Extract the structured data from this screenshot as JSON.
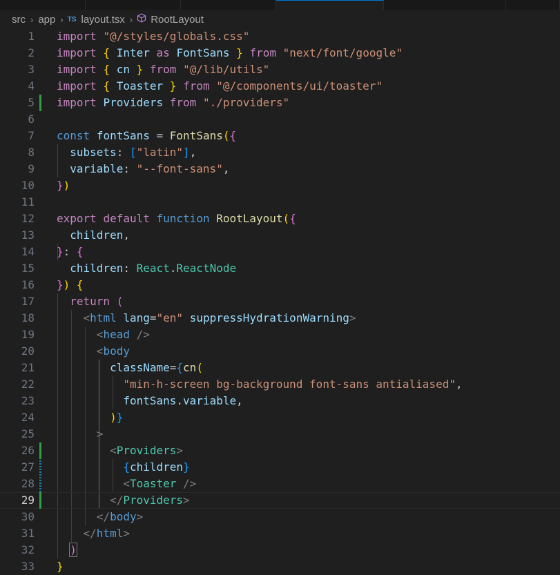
{
  "breadcrumb": {
    "items": [
      "src",
      "app",
      "layout.tsx",
      "RootLayout"
    ],
    "file_icon_text": "TS"
  },
  "editor": {
    "current_line": 29,
    "lines": [
      {
        "n": "1",
        "tokens": [
          [
            "kw",
            "import"
          ],
          [
            "p",
            " "
          ],
          [
            "str",
            "\"@/styles/globals.css\""
          ]
        ]
      },
      {
        "n": "2",
        "tokens": [
          [
            "kw",
            "import"
          ],
          [
            "p",
            " "
          ],
          [
            "b1",
            "{"
          ],
          [
            "p",
            " "
          ],
          [
            "var",
            "Inter"
          ],
          [
            "p",
            " "
          ],
          [
            "kw",
            "as"
          ],
          [
            "p",
            " "
          ],
          [
            "var",
            "FontSans"
          ],
          [
            "p",
            " "
          ],
          [
            "b1",
            "}"
          ],
          [
            "p",
            " "
          ],
          [
            "kw",
            "from"
          ],
          [
            "p",
            " "
          ],
          [
            "str",
            "\"next/font/google\""
          ]
        ]
      },
      {
        "n": "3",
        "tokens": [
          [
            "kw",
            "import"
          ],
          [
            "p",
            " "
          ],
          [
            "b1",
            "{"
          ],
          [
            "p",
            " "
          ],
          [
            "var",
            "cn"
          ],
          [
            "p",
            " "
          ],
          [
            "b1",
            "}"
          ],
          [
            "p",
            " "
          ],
          [
            "kw",
            "from"
          ],
          [
            "p",
            " "
          ],
          [
            "str",
            "\"@/lib/utils\""
          ]
        ]
      },
      {
        "n": "4",
        "tokens": [
          [
            "kw",
            "import"
          ],
          [
            "p",
            " "
          ],
          [
            "b1",
            "{"
          ],
          [
            "p",
            " "
          ],
          [
            "var",
            "Toaster"
          ],
          [
            "p",
            " "
          ],
          [
            "b1",
            "}"
          ],
          [
            "p",
            " "
          ],
          [
            "kw",
            "from"
          ],
          [
            "p",
            " "
          ],
          [
            "str",
            "\"@/components/ui/toaster\""
          ]
        ]
      },
      {
        "n": "5",
        "gutter": "added",
        "tokens": [
          [
            "kw",
            "import"
          ],
          [
            "p",
            " "
          ],
          [
            "var",
            "Providers"
          ],
          [
            "p",
            " "
          ],
          [
            "kw",
            "from"
          ],
          [
            "p",
            " "
          ],
          [
            "str",
            "\"./providers\""
          ]
        ]
      },
      {
        "n": "6",
        "tokens": []
      },
      {
        "n": "7",
        "tokens": [
          [
            "st",
            "const"
          ],
          [
            "p",
            " "
          ],
          [
            "var",
            "fontSans"
          ],
          [
            "p",
            " = "
          ],
          [
            "fn",
            "FontSans"
          ],
          [
            "b1",
            "("
          ],
          [
            "b2",
            "{"
          ]
        ]
      },
      {
        "n": "8",
        "tokens": [
          [
            "p",
            "  "
          ],
          [
            "var",
            "subsets"
          ],
          [
            "p",
            ": "
          ],
          [
            "b3",
            "["
          ],
          [
            "str",
            "\"latin\""
          ],
          [
            "b3",
            "]"
          ],
          [
            "p",
            ","
          ]
        ]
      },
      {
        "n": "9",
        "tokens": [
          [
            "p",
            "  "
          ],
          [
            "var",
            "variable"
          ],
          [
            "p",
            ": "
          ],
          [
            "str",
            "\"--font-sans\""
          ],
          [
            "p",
            ","
          ]
        ]
      },
      {
        "n": "10",
        "tokens": [
          [
            "b2",
            "}"
          ],
          [
            "b1",
            ")"
          ]
        ]
      },
      {
        "n": "11",
        "tokens": []
      },
      {
        "n": "12",
        "tokens": [
          [
            "kw",
            "export"
          ],
          [
            "p",
            " "
          ],
          [
            "kw",
            "default"
          ],
          [
            "p",
            " "
          ],
          [
            "st",
            "function"
          ],
          [
            "p",
            " "
          ],
          [
            "fn",
            "RootLayout"
          ],
          [
            "b1",
            "("
          ],
          [
            "b2",
            "{"
          ]
        ]
      },
      {
        "n": "13",
        "tokens": [
          [
            "p",
            "  "
          ],
          [
            "var",
            "children"
          ],
          [
            "p",
            ","
          ]
        ]
      },
      {
        "n": "14",
        "tokens": [
          [
            "b2",
            "}"
          ],
          [
            "p",
            ": "
          ],
          [
            "b2",
            "{"
          ]
        ]
      },
      {
        "n": "15",
        "tokens": [
          [
            "p",
            "  "
          ],
          [
            "var",
            "children"
          ],
          [
            "p",
            ": "
          ],
          [
            "ty",
            "React"
          ],
          [
            "p",
            "."
          ],
          [
            "ty",
            "ReactNode"
          ]
        ]
      },
      {
        "n": "16",
        "tokens": [
          [
            "b2",
            "}"
          ],
          [
            "b1",
            ")"
          ],
          [
            "p",
            " "
          ],
          [
            "b1",
            "{"
          ]
        ]
      },
      {
        "n": "17",
        "tokens": [
          [
            "p",
            "  "
          ],
          [
            "kw",
            "return"
          ],
          [
            "p",
            " "
          ],
          [
            "b2",
            "("
          ]
        ]
      },
      {
        "n": "18",
        "tokens": [
          [
            "p",
            "    "
          ],
          [
            "ang",
            "<"
          ],
          [
            "tag",
            "html"
          ],
          [
            "p",
            " "
          ],
          [
            "var",
            "lang"
          ],
          [
            "p",
            "="
          ],
          [
            "str",
            "\"en\""
          ],
          [
            "p",
            " "
          ],
          [
            "var",
            "suppressHydrationWarning"
          ],
          [
            "ang",
            ">"
          ]
        ]
      },
      {
        "n": "19",
        "tokens": [
          [
            "p",
            "      "
          ],
          [
            "ang",
            "<"
          ],
          [
            "tag",
            "head"
          ],
          [
            "p",
            " "
          ],
          [
            "ang",
            "/>"
          ]
        ]
      },
      {
        "n": "20",
        "tokens": [
          [
            "p",
            "      "
          ],
          [
            "ang",
            "<"
          ],
          [
            "tag",
            "body"
          ]
        ]
      },
      {
        "n": "21",
        "tokens": [
          [
            "p",
            "        "
          ],
          [
            "var",
            "className"
          ],
          [
            "p",
            "="
          ],
          [
            "b3",
            "{"
          ],
          [
            "fn",
            "cn"
          ],
          [
            "b1",
            "("
          ]
        ]
      },
      {
        "n": "22",
        "tokens": [
          [
            "p",
            "          "
          ],
          [
            "str",
            "\"min-h-screen bg-background font-sans antialiased\""
          ],
          [
            "p",
            ","
          ]
        ]
      },
      {
        "n": "23",
        "tokens": [
          [
            "p",
            "          "
          ],
          [
            "var",
            "fontSans"
          ],
          [
            "p",
            "."
          ],
          [
            "var",
            "variable"
          ],
          [
            "p",
            ","
          ]
        ]
      },
      {
        "n": "24",
        "tokens": [
          [
            "p",
            "        "
          ],
          [
            "b1",
            ")"
          ],
          [
            "b3",
            "}"
          ]
        ]
      },
      {
        "n": "25",
        "tokens": [
          [
            "p",
            "      "
          ],
          [
            "ang",
            ">"
          ]
        ]
      },
      {
        "n": "26",
        "gutter": "added",
        "tokens": [
          [
            "p",
            "        "
          ],
          [
            "ang",
            "<"
          ],
          [
            "ty",
            "Providers"
          ],
          [
            "ang",
            ">"
          ]
        ]
      },
      {
        "n": "27",
        "gutter": "modified",
        "tokens": [
          [
            "p",
            "          "
          ],
          [
            "b3",
            "{"
          ],
          [
            "var",
            "children"
          ],
          [
            "b3",
            "}"
          ]
        ]
      },
      {
        "n": "28",
        "gutter": "modified",
        "tokens": [
          [
            "p",
            "          "
          ],
          [
            "ang",
            "<"
          ],
          [
            "ty",
            "Toaster"
          ],
          [
            "p",
            " "
          ],
          [
            "ang",
            "/>"
          ]
        ]
      },
      {
        "n": "29",
        "gutter": "added",
        "tokens": [
          [
            "p",
            "        "
          ],
          [
            "ang",
            "</"
          ],
          [
            "ty",
            "Providers"
          ],
          [
            "ang",
            ">"
          ]
        ]
      },
      {
        "n": "30",
        "tokens": [
          [
            "p",
            "      "
          ],
          [
            "ang",
            "</"
          ],
          [
            "tag",
            "body"
          ],
          [
            "ang",
            ">"
          ]
        ]
      },
      {
        "n": "31",
        "tokens": [
          [
            "p",
            "    "
          ],
          [
            "ang",
            "</"
          ],
          [
            "tag",
            "html"
          ],
          [
            "ang",
            ">"
          ]
        ]
      },
      {
        "n": "32",
        "tokens": [
          [
            "p",
            "  "
          ],
          [
            "b2",
            ")"
          ]
        ]
      },
      {
        "n": "33",
        "tokens": [
          [
            "b1",
            "}"
          ]
        ]
      }
    ]
  }
}
